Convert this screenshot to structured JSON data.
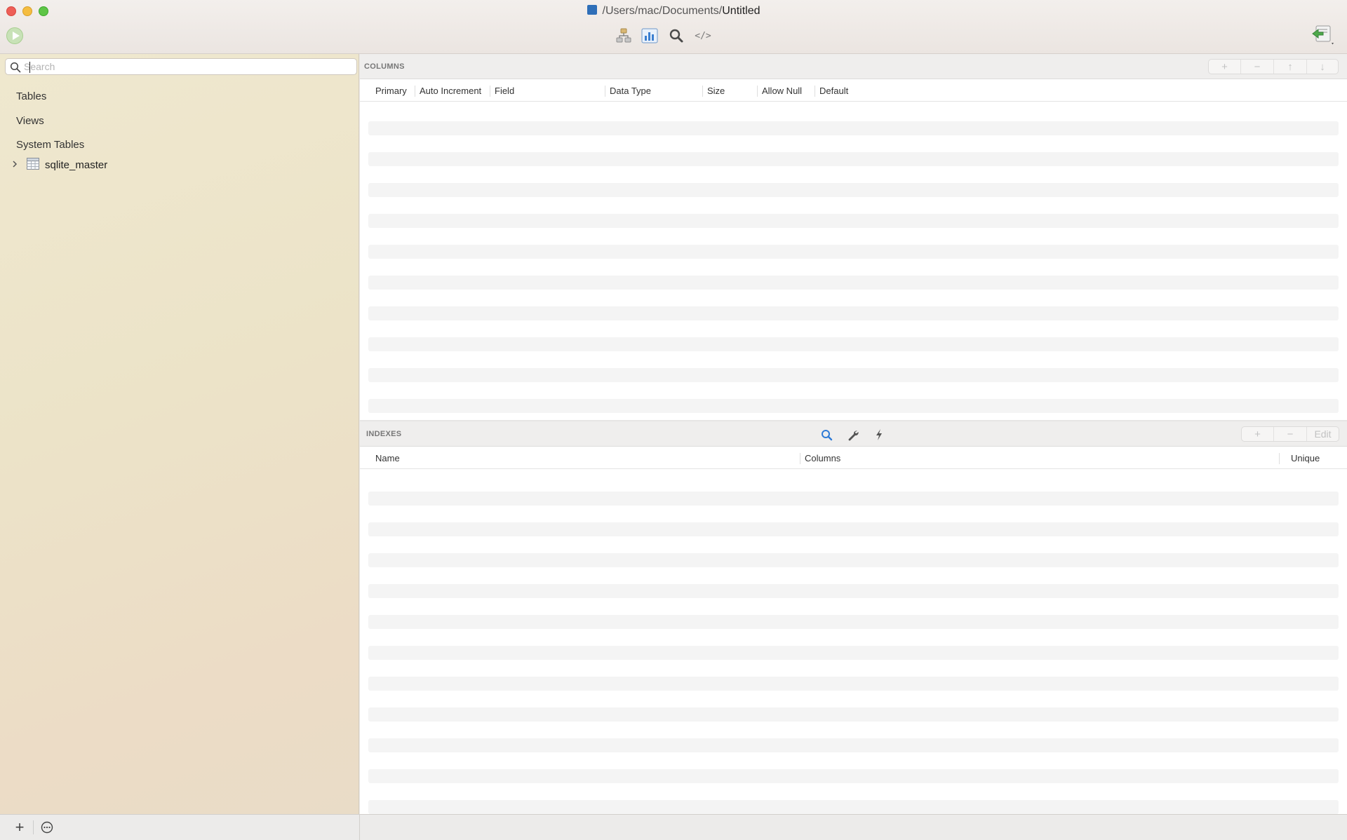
{
  "window": {
    "path_prefix": "/Users/mac/Documents/",
    "document_name": "Untitled"
  },
  "toolbar": {
    "run_icon": "play-icon",
    "structure_icon": "structure-icon",
    "chart_icon": "chart-icon",
    "search_icon": "search-icon",
    "code_label": "</>",
    "export_icon": "export-icon"
  },
  "sidebar": {
    "search": {
      "placeholder": "Search",
      "value": ""
    },
    "groups": {
      "tables": "Tables",
      "views": "Views",
      "system_tables": "System Tables"
    },
    "system_table_items": [
      {
        "name": "sqlite_master",
        "expanded": false
      }
    ]
  },
  "columns_section": {
    "title": "COLUMNS",
    "buttons": [
      "+",
      "−",
      "↑",
      "↓"
    ],
    "headers": [
      "Primary",
      "Auto Increment",
      "Field",
      "Data Type",
      "Size",
      "Allow Null",
      "Default"
    ],
    "rows": []
  },
  "indexes_section": {
    "title": "INDEXES",
    "tools": [
      "search-icon",
      "wrench-icon",
      "lightning-icon"
    ],
    "buttons": [
      "+",
      "−",
      "Edit"
    ],
    "headers": [
      "Name",
      "Columns",
      "Unique"
    ],
    "rows": []
  },
  "bottom_bar": {
    "add_label": "+",
    "more_icon": "ellipsis-circle-icon"
  },
  "colors": {
    "accent_blue": "#2f7bd6",
    "run_green": "#c8e2b7",
    "sidebar_bg": "#ece3c8"
  }
}
